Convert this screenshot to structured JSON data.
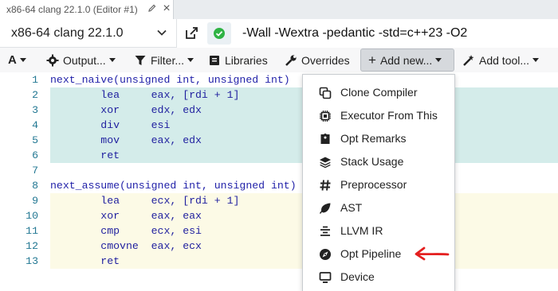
{
  "tab": {
    "title": "x86-64 clang 22.1.0 (Editor #1)",
    "edit_icon": "pencil-icon",
    "close_label": "×"
  },
  "compiler": {
    "name": "x86-64 clang 22.1.0",
    "flags": "-Wall -Wextra -pedantic -std=c++23 -O2",
    "status": "ok",
    "status_color": "#2fb344"
  },
  "toolbar": {
    "font_label": "A",
    "output_label": "Output...",
    "filter_label": "Filter...",
    "libraries_label": "Libraries",
    "overrides_label": "Overrides",
    "add_new_label": "Add new...",
    "add_tool_label": "Add tool..."
  },
  "editor": {
    "lines": [
      {
        "num": "1",
        "text": "next_naive(unsigned int, unsigned int)"
      },
      {
        "num": "2",
        "text": "        lea     eax, [rdi + 1]"
      },
      {
        "num": "3",
        "text": "        xor     edx, edx"
      },
      {
        "num": "4",
        "text": "        div     esi"
      },
      {
        "num": "5",
        "text": "        mov     eax, edx"
      },
      {
        "num": "6",
        "text": "        ret"
      },
      {
        "num": "7",
        "text": ""
      },
      {
        "num": "8",
        "text": "next_assume(unsigned int, unsigned int)"
      },
      {
        "num": "9",
        "text": "        lea     ecx, [rdi + 1]"
      },
      {
        "num": "10",
        "text": "        xor     eax, eax"
      },
      {
        "num": "11",
        "text": "        cmp     ecx, esi"
      },
      {
        "num": "12",
        "text": "        cmovne  eax, ecx"
      },
      {
        "num": "13",
        "text": "        ret"
      }
    ],
    "highlight_colors": {
      "block1": "#d4ecea",
      "block2": "#fcfae6"
    }
  },
  "add_new_menu": {
    "items": [
      {
        "label": "Clone Compiler",
        "icon": "clone-icon"
      },
      {
        "label": "Executor From This",
        "icon": "microchip-icon"
      },
      {
        "label": "Opt Remarks",
        "icon": "remarks-icon"
      },
      {
        "label": "Stack Usage",
        "icon": "layers-icon"
      },
      {
        "label": "Preprocessor",
        "icon": "hashtag-icon"
      },
      {
        "label": "AST",
        "icon": "tree-leaf-icon"
      },
      {
        "label": "LLVM IR",
        "icon": "align-center-icon"
      },
      {
        "label": "Opt Pipeline",
        "icon": "compass-icon"
      },
      {
        "label": "Device",
        "icon": "monitor-icon"
      }
    ]
  },
  "annotation": {
    "arrow_color": "#e41f1f"
  }
}
